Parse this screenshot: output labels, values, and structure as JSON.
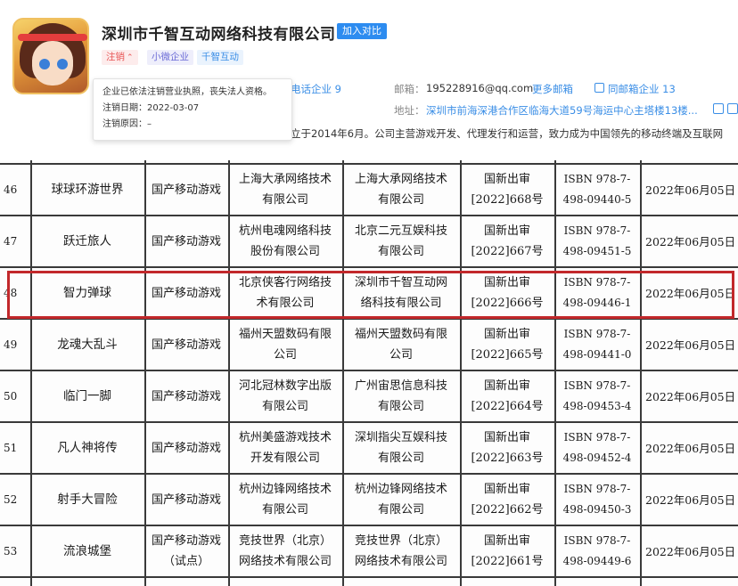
{
  "company": {
    "name": "深圳市千智互动网络科技有限公司",
    "compare_button": "加入对比",
    "tags": {
      "status": "注销",
      "size": "小微企业",
      "brand": "千智互动"
    },
    "tooltip": {
      "line1": "企业已依法注销营业执照，丧失法人资格。",
      "line2": "注销日期：2022-03-07",
      "line3": "注销原因：–"
    },
    "phone_link": "电话企业 9",
    "email_label": "邮箱：",
    "email_value": "195228916@qq.com",
    "more_email": "更多邮箱",
    "same_email": "同邮箱企业 13",
    "address_label": "地址：",
    "address_value": "深圳市前海深港合作区临海大道59号海运中心主塔楼13楼...",
    "intro": "立于2014年6月。公司主营游戏开发、代理发行和运营，致力成为中国领先的移动终端及互联网"
  },
  "table": {
    "rows": [
      {
        "no": "46",
        "name": "球球环游世界",
        "category": "国产移动游戏",
        "publisher": "上海大承网络技术\n有限公司",
        "operator": "上海大承网络技术\n有限公司",
        "approval": "国新出审\n[2022]668号",
        "isbn": "ISBN 978-7-\n498-09440-5",
        "date": "2022年06月05日"
      },
      {
        "no": "47",
        "name": "跃迁旅人",
        "category": "国产移动游戏",
        "publisher": "杭州电魂网络科技\n股份有限公司",
        "operator": "北京二元互娱科技\n有限公司",
        "approval": "国新出审\n[2022]667号",
        "isbn": "ISBN 978-7-\n498-09451-5",
        "date": "2022年06月05日"
      },
      {
        "no": "48",
        "name": "智力弹球",
        "category": "国产移动游戏",
        "publisher": "北京侠客行网络技\n术有限公司",
        "operator": "深圳市千智互动网\n络科技有限公司",
        "approval": "国新出审\n[2022]666号",
        "isbn": "ISBN 978-7-\n498-09446-1",
        "date": "2022年06月05日"
      },
      {
        "no": "49",
        "name": "龙魂大乱斗",
        "category": "国产移动游戏",
        "publisher": "福州天盟数码有限\n公司",
        "operator": "福州天盟数码有限\n公司",
        "approval": "国新出审\n[2022]665号",
        "isbn": "ISBN 978-7-\n498-09441-0",
        "date": "2022年06月05日"
      },
      {
        "no": "50",
        "name": "临门一脚",
        "category": "国产移动游戏",
        "publisher": "河北冠林数字出版\n有限公司",
        "operator": "广州宙思信息科技\n有限公司",
        "approval": "国新出审\n[2022]664号",
        "isbn": "ISBN 978-7-\n498-09453-4",
        "date": "2022年06月05日"
      },
      {
        "no": "51",
        "name": "凡人神将传",
        "category": "国产移动游戏",
        "publisher": "杭州美盛游戏技术\n开发有限公司",
        "operator": "深圳指尖互娱科技\n有限公司",
        "approval": "国新出审\n[2022]663号",
        "isbn": "ISBN 978-7-\n498-09452-4",
        "date": "2022年06月05日"
      },
      {
        "no": "52",
        "name": "射手大冒险",
        "category": "国产移动游戏",
        "publisher": "杭州边锋网络技术\n有限公司",
        "operator": "杭州边锋网络技术\n有限公司",
        "approval": "国新出审\n[2022]662号",
        "isbn": "ISBN 978-7-\n498-09450-3",
        "date": "2022年06月05日"
      },
      {
        "no": "53",
        "name": "流浪城堡",
        "category": "国产移动游戏\n（试点）",
        "publisher": "竞技世界（北京）\n网络技术有限公司",
        "operator": "竞技世界（北京）\n网络技术有限公司",
        "approval": "国新出审\n[2022]661号",
        "isbn": "ISBN 978-7-\n498-09449-6",
        "date": "2022年06月05日"
      }
    ]
  },
  "colors": {
    "accent": "#2d8cf0",
    "link": "#3a8ee6",
    "status_red": "#e85454",
    "highlight": "#c2282b"
  }
}
